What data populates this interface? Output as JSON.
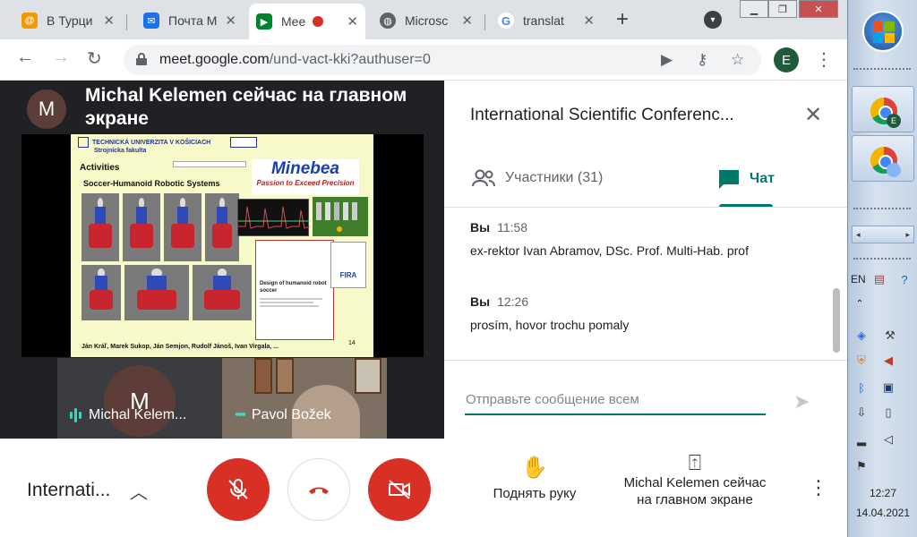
{
  "browser": {
    "tabs": [
      {
        "title": "В Турци",
        "favicon": "at-sign-icon",
        "color": "#f29900"
      },
      {
        "title": "Почта M",
        "favicon": "mail-icon",
        "color": "#1a73e8"
      },
      {
        "title": "Mee",
        "favicon": "meet-icon",
        "color": "#00832d",
        "active": true
      },
      {
        "title": "Microsc",
        "favicon": "globe-icon",
        "color": "#5f6368"
      },
      {
        "title": "translat",
        "favicon": "google-icon",
        "color": "#4285f4"
      }
    ],
    "new_tab": "+",
    "url_host": "meet.google.com",
    "url_path": "/und-vact-kki?authuser=0",
    "profile_initial": "E"
  },
  "meet": {
    "presenter_initial": "M",
    "presenter_title": "Michal Kelemen сейчас на главном экране",
    "slide": {
      "uni_name": "TECHNICKÁ UNIVERZITA V KOŠICIACH",
      "faculty": "Strojnícka fakulta",
      "activities": "Activities",
      "subtitle": "Soccer-Humanoid Robotic Systems",
      "minebea": "Minebea",
      "minebea_tagline": "Passion to Exceed Precision",
      "paper_title": "Design of humanoid robot soccer",
      "fira": "FIRA",
      "authors": "Ján Kráľ, Marek Sukop, Ján Semjon, Rudolf Jánoš, Ivan Virgala, ...",
      "page": "14"
    },
    "tiles": [
      {
        "name": "Michal Kelem...",
        "initial": "M"
      },
      {
        "name": "Pavol Božek"
      }
    ]
  },
  "panel": {
    "title": "International Scientific Conferenc...",
    "tab_people": "Участники (31)",
    "tab_chat": "Чат",
    "messages": [
      {
        "sender": "Вы",
        "time": "11:58",
        "text": "ex-rektor Ivan Abramov, DSc. Prof. Multi-Hab. prof"
      },
      {
        "sender": "Вы",
        "time": "12:26",
        "text": "prosím, hovor trochu pomaly"
      }
    ],
    "composer_placeholder": "Отправьте сообщение всем"
  },
  "bottom": {
    "meeting_name": "Internati...",
    "raise_hand": "Поднять руку",
    "presenting": "Michal Kelemen сейчас на главном экране"
  },
  "taskbar": {
    "lang": "EN",
    "time": "12:27",
    "date": "14.04.2021"
  },
  "colors": {
    "accent": "#00796b",
    "danger": "#d93025",
    "stage_bg": "#202124"
  }
}
